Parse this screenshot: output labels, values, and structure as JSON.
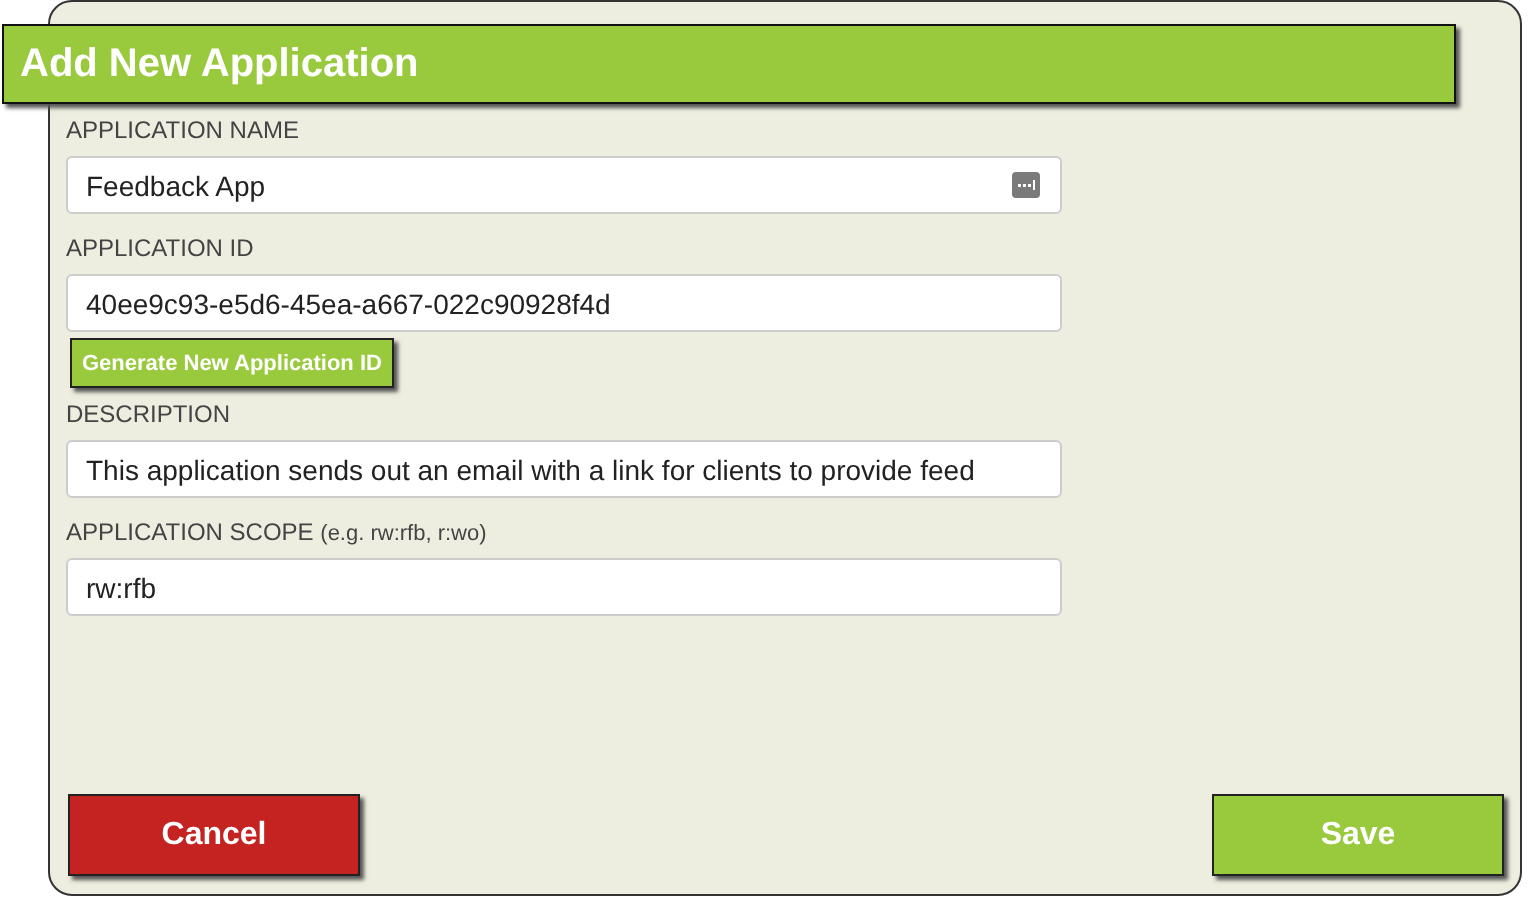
{
  "dialog": {
    "title": "Add New Application"
  },
  "fields": [
    {
      "label": "APPLICATION NAME",
      "value": "Feedback App",
      "kind": "autofill"
    },
    {
      "label": "APPLICATION ID",
      "value": "40ee9c93-e5d6-45ea-a667-022c90928f4d",
      "kind": "generate",
      "action": "Generate New Application ID"
    },
    {
      "label": "DESCRIPTION",
      "value": "This application sends out an email with a link for clients to provide feed",
      "kind": "plain"
    },
    {
      "label": "APPLICATION SCOPE",
      "hint": "(e.g. rw:rfb, r:wo)",
      "value": "rw:rfb",
      "kind": "plain"
    }
  ],
  "buttons": [
    {
      "label": "Cancel",
      "kind": "danger"
    },
    {
      "label": "Save",
      "kind": "primary"
    }
  ]
}
